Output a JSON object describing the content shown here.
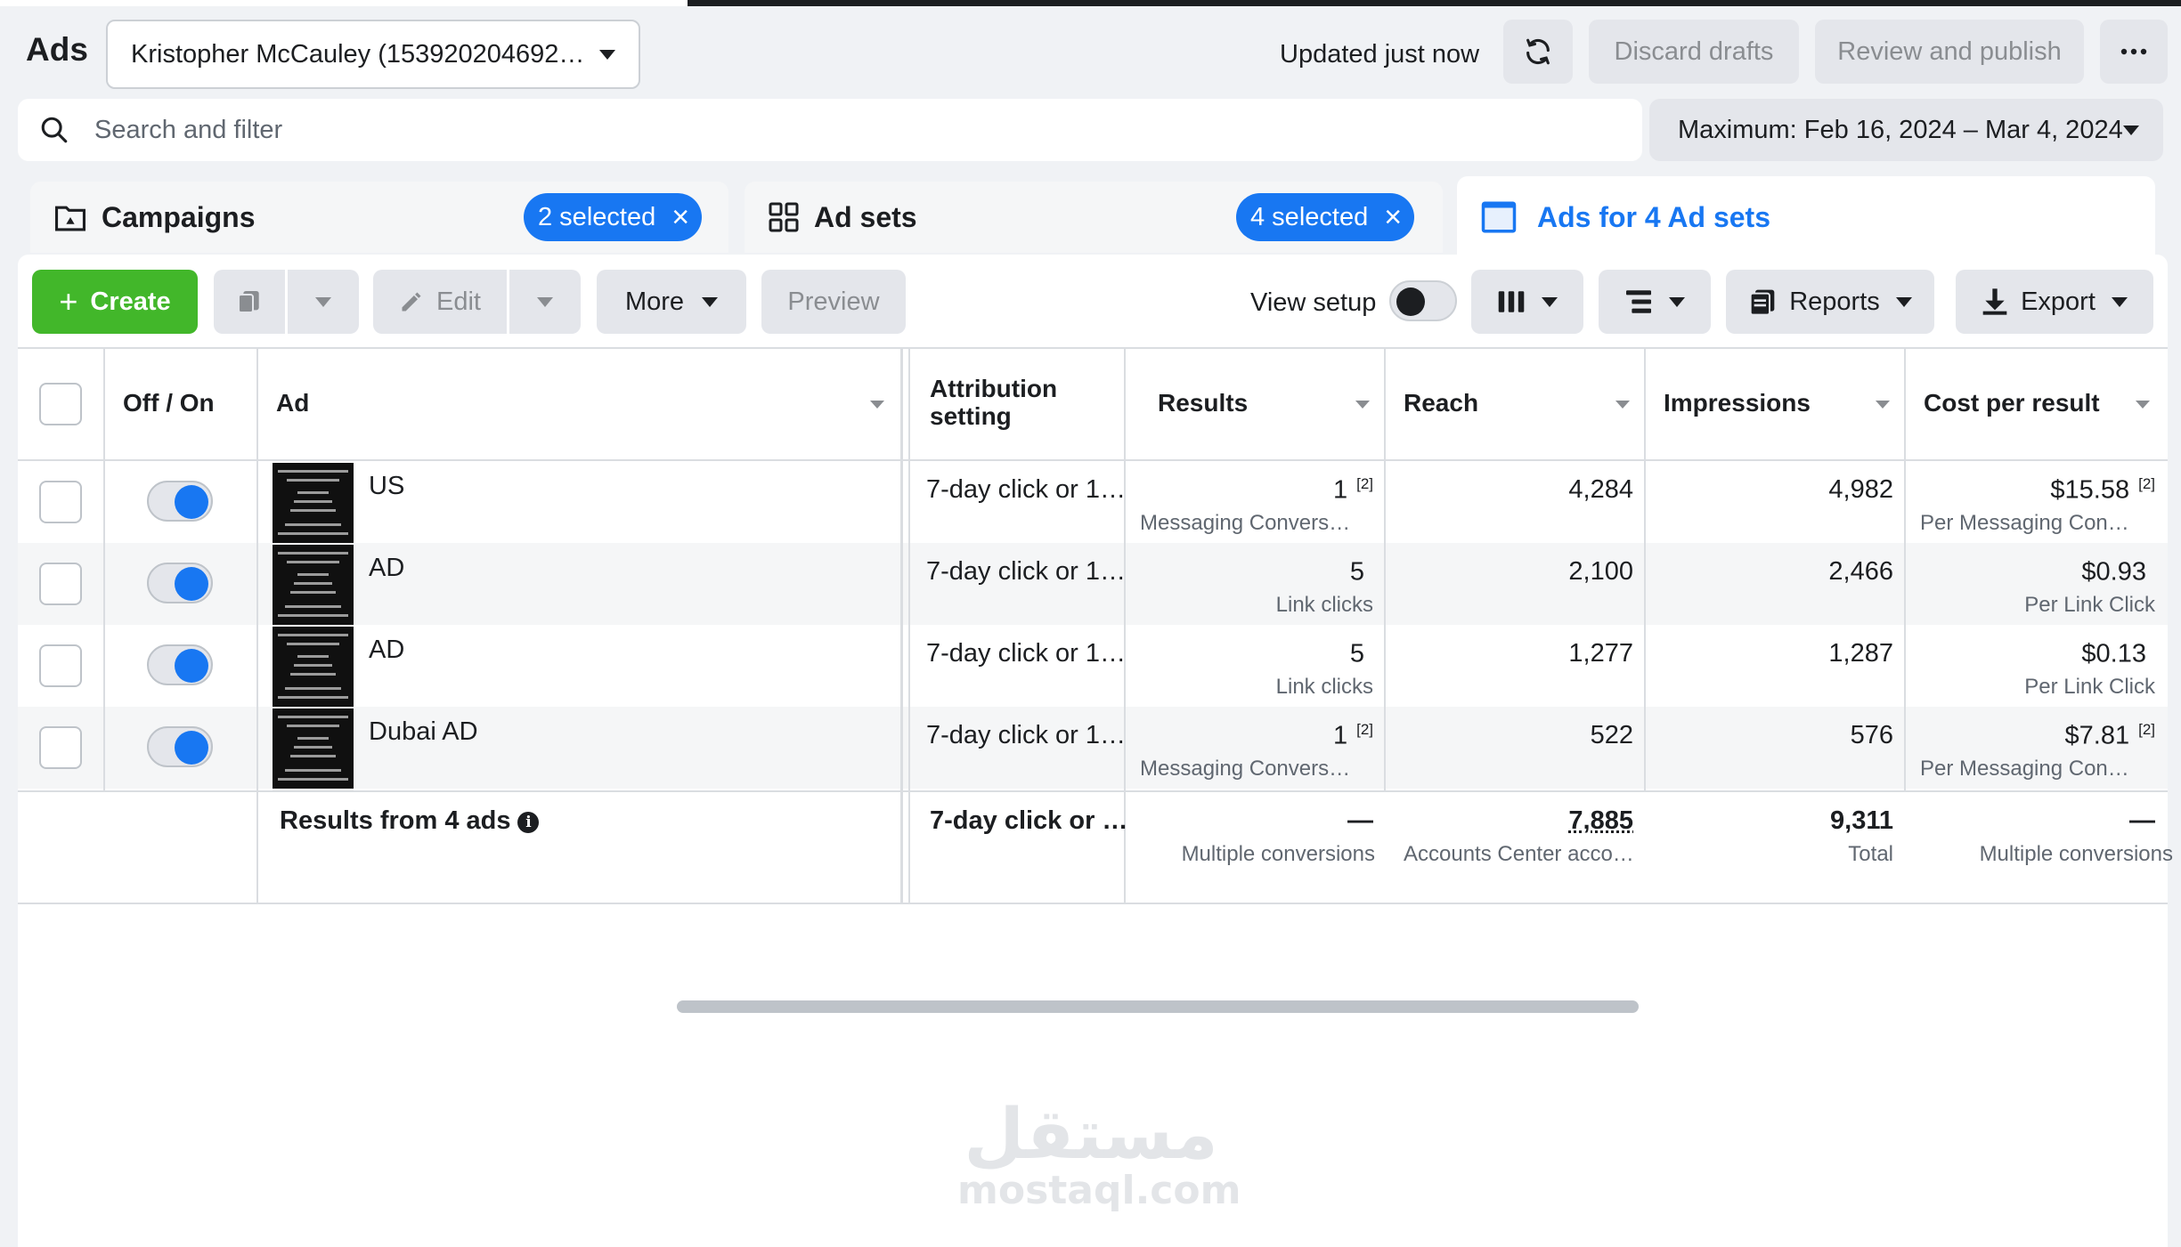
{
  "header": {
    "app_title": "Ads",
    "account": "Kristopher McCauley (153920204692…",
    "updated": "Updated just now",
    "discard": "Discard drafts",
    "review": "Review and publish"
  },
  "search": {
    "placeholder": "Search and filter"
  },
  "date_range": "Maximum: Feb 16, 2024 – Mar 4, 2024",
  "tabs": {
    "campaigns": {
      "label": "Campaigns",
      "selected": "2 selected"
    },
    "adsets": {
      "label": "Ad sets",
      "selected": "4 selected"
    },
    "ads": {
      "label": "Ads for 4 Ad sets"
    }
  },
  "toolbar": {
    "create": "Create",
    "edit": "Edit",
    "more": "More",
    "preview": "Preview",
    "view_setup": "View setup",
    "reports": "Reports",
    "export": "Export"
  },
  "table": {
    "headers": {
      "off_on": "Off / On",
      "ad": "Ad",
      "attribution": "Attribution setting",
      "results": "Results",
      "reach": "Reach",
      "impressions": "Impressions",
      "cost": "Cost per result"
    },
    "rows": [
      {
        "name": "US",
        "attribution": "7-day click or 1…",
        "results": "1",
        "results_sup": "[2]",
        "results_sub": "Messaging Convers…",
        "reach": "4,284",
        "impressions": "4,982",
        "cost": "$15.58",
        "cost_sup": "[2]",
        "cost_sub": "Per Messaging Con…",
        "on": true
      },
      {
        "name": "AD",
        "attribution": "7-day click or 1…",
        "results": "5",
        "results_sup": "",
        "results_sub": "Link clicks",
        "reach": "2,100",
        "impressions": "2,466",
        "cost": "$0.93",
        "cost_sup": "",
        "cost_sub": "Per Link Click",
        "on": true
      },
      {
        "name": "AD",
        "attribution": "7-day click or 1…",
        "results": "5",
        "results_sup": "",
        "results_sub": "Link clicks",
        "reach": "1,277",
        "impressions": "1,287",
        "cost": "$0.13",
        "cost_sup": "",
        "cost_sub": "Per Link Click",
        "on": true
      },
      {
        "name": "Dubai AD",
        "attribution": "7-day click or 1…",
        "results": "1",
        "results_sup": "[2]",
        "results_sub": "Messaging Convers…",
        "reach": "522",
        "impressions": "576",
        "cost": "$7.81",
        "cost_sup": "[2]",
        "cost_sub": "Per Messaging Con…",
        "on": true
      }
    ],
    "summary": {
      "label": "Results from 4 ads",
      "attribution": "7-day click or …",
      "results": "—",
      "results_sub": "Multiple conversions",
      "reach": "7,885",
      "reach_sub": "Accounts Center acco…",
      "impressions": "9,311",
      "impressions_sub": "Total",
      "cost": "—",
      "cost_sub": "Multiple conversions"
    },
    "thumb_text": [
      "Remove Negative",
      "Gmb Reviews",
      "-Safe",
      "-Zero Risk",
      "-Guaranteed",
      "Dm us the word",
      "\"READY\" to Start"
    ]
  },
  "watermark": {
    "arabic": "مستقل",
    "latin": "mostaql.com"
  },
  "colors": {
    "accent": "#1877f2",
    "create": "#42b72a",
    "background": "#f0f2f5"
  }
}
